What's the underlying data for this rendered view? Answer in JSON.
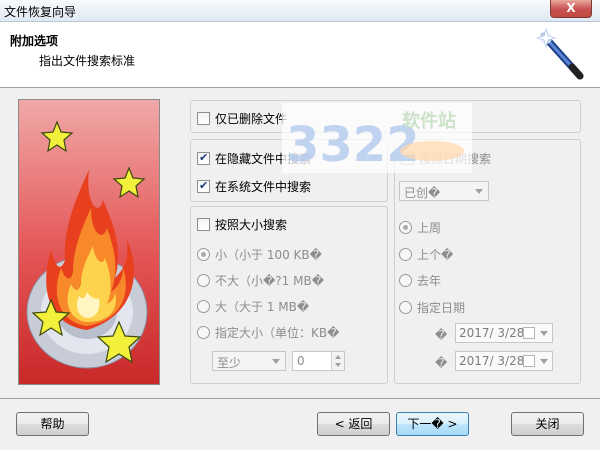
{
  "window": {
    "title": "文件恢复向导",
    "close_label": "X"
  },
  "header": {
    "title": "附加选项",
    "subtitle": "指出文件搜索标准"
  },
  "options": {
    "deleted_only": "仅已删除文件",
    "hidden_files": "在隐藏文件中搜索",
    "system_files": "在系统文件中搜索"
  },
  "size_group": {
    "checkbox": "按照大小搜索",
    "options": [
      "小（小于 100 KB�",
      "不大（小�?1 MB�",
      "大（大于 1 MB�",
      "指定大小（单位：KB�"
    ],
    "qualifier": "至少",
    "value": "0"
  },
  "date_group": {
    "checkbox": "按照日期搜索",
    "date_type": "已创�",
    "options": [
      "上周",
      "上个�",
      "去年",
      "指定日期"
    ],
    "from_label": "�",
    "from_date": "2017/  3/28",
    "to_label": "�",
    "to_date": "2017/  3/28"
  },
  "watermark": {
    "number": "3322",
    "text": "软件站"
  },
  "buttons": {
    "help": "帮助",
    "back": "< 返回",
    "next": "下一� >",
    "close": "关闭"
  }
}
